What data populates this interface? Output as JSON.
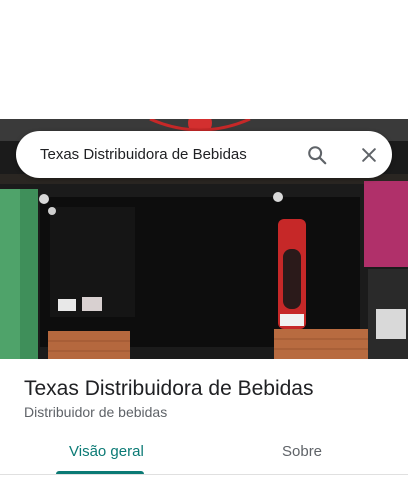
{
  "search": {
    "query": "Texas Distribuidora de Bebidas",
    "search_icon": "search-icon",
    "close_icon": "close-icon"
  },
  "place": {
    "name": "Texas Distribuidora de Bebidas",
    "category": "Distribuidor de bebidas"
  },
  "tabs": [
    {
      "label": "Visão geral",
      "active": true
    },
    {
      "label": "Sobre",
      "active": false
    }
  ],
  "colors": {
    "accent": "#0b7a75",
    "title_text": "#202124",
    "secondary_text": "#5f6368"
  }
}
